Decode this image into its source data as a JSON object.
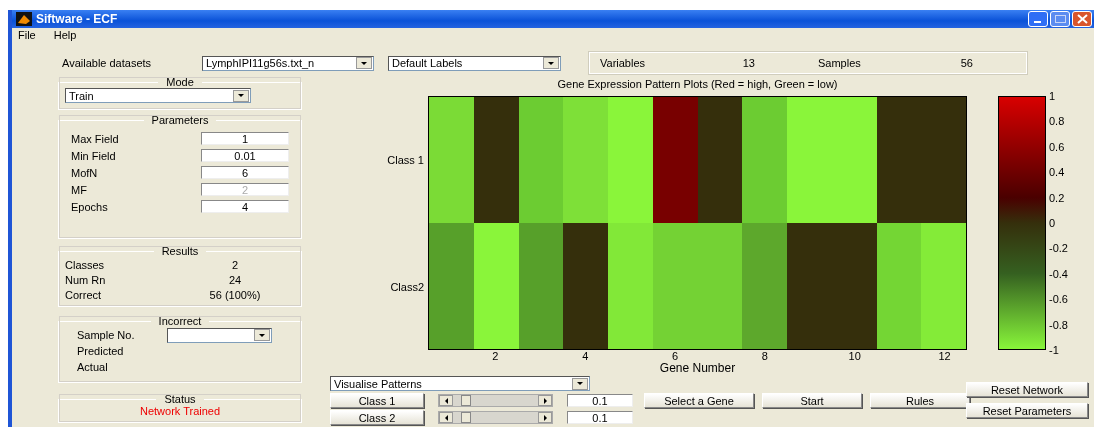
{
  "window": {
    "title": "Siftware - ECF"
  },
  "menu": [
    "File",
    "Help"
  ],
  "datasets": {
    "label": "Available datasets",
    "dataset_value": "LymphIPI11g56s.txt_n",
    "labels_value": "Default Labels"
  },
  "info": [
    {
      "label": "Variables",
      "value": "13"
    },
    {
      "label": "Samples",
      "value": "56"
    }
  ],
  "mode": {
    "title": "Mode",
    "value": "Train"
  },
  "parameters": {
    "title": "Parameters",
    "fields": [
      {
        "label": "Max Field",
        "value": "1",
        "disabled": false
      },
      {
        "label": "Min Field",
        "value": "0.01",
        "disabled": false
      },
      {
        "label": "MofN",
        "value": "6",
        "disabled": false
      },
      {
        "label": "MF",
        "value": "2",
        "disabled": true
      },
      {
        "label": "Epochs",
        "value": "4",
        "disabled": false
      }
    ]
  },
  "results": {
    "title": "Results",
    "rows": [
      {
        "label": "Classes",
        "value": "2"
      },
      {
        "label": "Num Rn",
        "value": "24"
      },
      {
        "label": "Correct",
        "value": "56  (100%)"
      }
    ]
  },
  "incorrect": {
    "title": "Incorrect",
    "sample_label": "Sample No.",
    "rows": [
      "Predicted",
      "Actual"
    ]
  },
  "status": {
    "title": "Status",
    "message": "Network Trained"
  },
  "plot": {
    "title": "Gene Expression Pattern Plots (Red = high, Green = low)",
    "rows": [
      {
        "label": "Class 1",
        "cells": [
          {
            "color": "#7bdb36"
          },
          {
            "color": "#352f0c"
          },
          {
            "color": "#6ccc32"
          },
          {
            "color": "#7ee038"
          },
          {
            "color": "#8af53a"
          },
          {
            "color": "#780000"
          },
          {
            "color": "#352f0c"
          },
          {
            "color": "#6ccc32"
          },
          {
            "color": "#8af53a"
          },
          {
            "color": "#8af53a"
          },
          {
            "color": "#352f0c"
          },
          {
            "color": "#352f0c"
          }
        ]
      },
      {
        "label": "Class2",
        "cells": [
          {
            "color": "#57a02a"
          },
          {
            "color": "#8af53a"
          },
          {
            "color": "#57a02a"
          },
          {
            "color": "#352f0c"
          },
          {
            "color": "#82e838"
          },
          {
            "color": "#74d234"
          },
          {
            "color": "#74d234"
          },
          {
            "color": "#5da82c"
          },
          {
            "color": "#352f0c"
          },
          {
            "color": "#352f0c"
          },
          {
            "color": "#74d634"
          },
          {
            "color": "#84eb38"
          }
        ]
      }
    ],
    "x_ticks": [
      "2",
      "4",
      "6",
      "8",
      "10",
      "12"
    ],
    "xlabel": "Gene Number",
    "colorbar_ticks": [
      "1",
      "0.8",
      "0.6",
      "0.4",
      "0.2",
      "0",
      "-0.2",
      "-0.4",
      "-0.6",
      "-0.8",
      "-1"
    ]
  },
  "controls": {
    "view": "Visualise Patterns",
    "classes": [
      {
        "label": "Class 1",
        "level": 0.1,
        "value": "0.1"
      },
      {
        "label": "Class 2",
        "level": 0.1,
        "value": "0.1"
      }
    ],
    "buttons": [
      "Select a Gene",
      "Start",
      "Rules"
    ],
    "reset_buttons": [
      "Reset Network",
      "Reset Parameters"
    ]
  }
}
